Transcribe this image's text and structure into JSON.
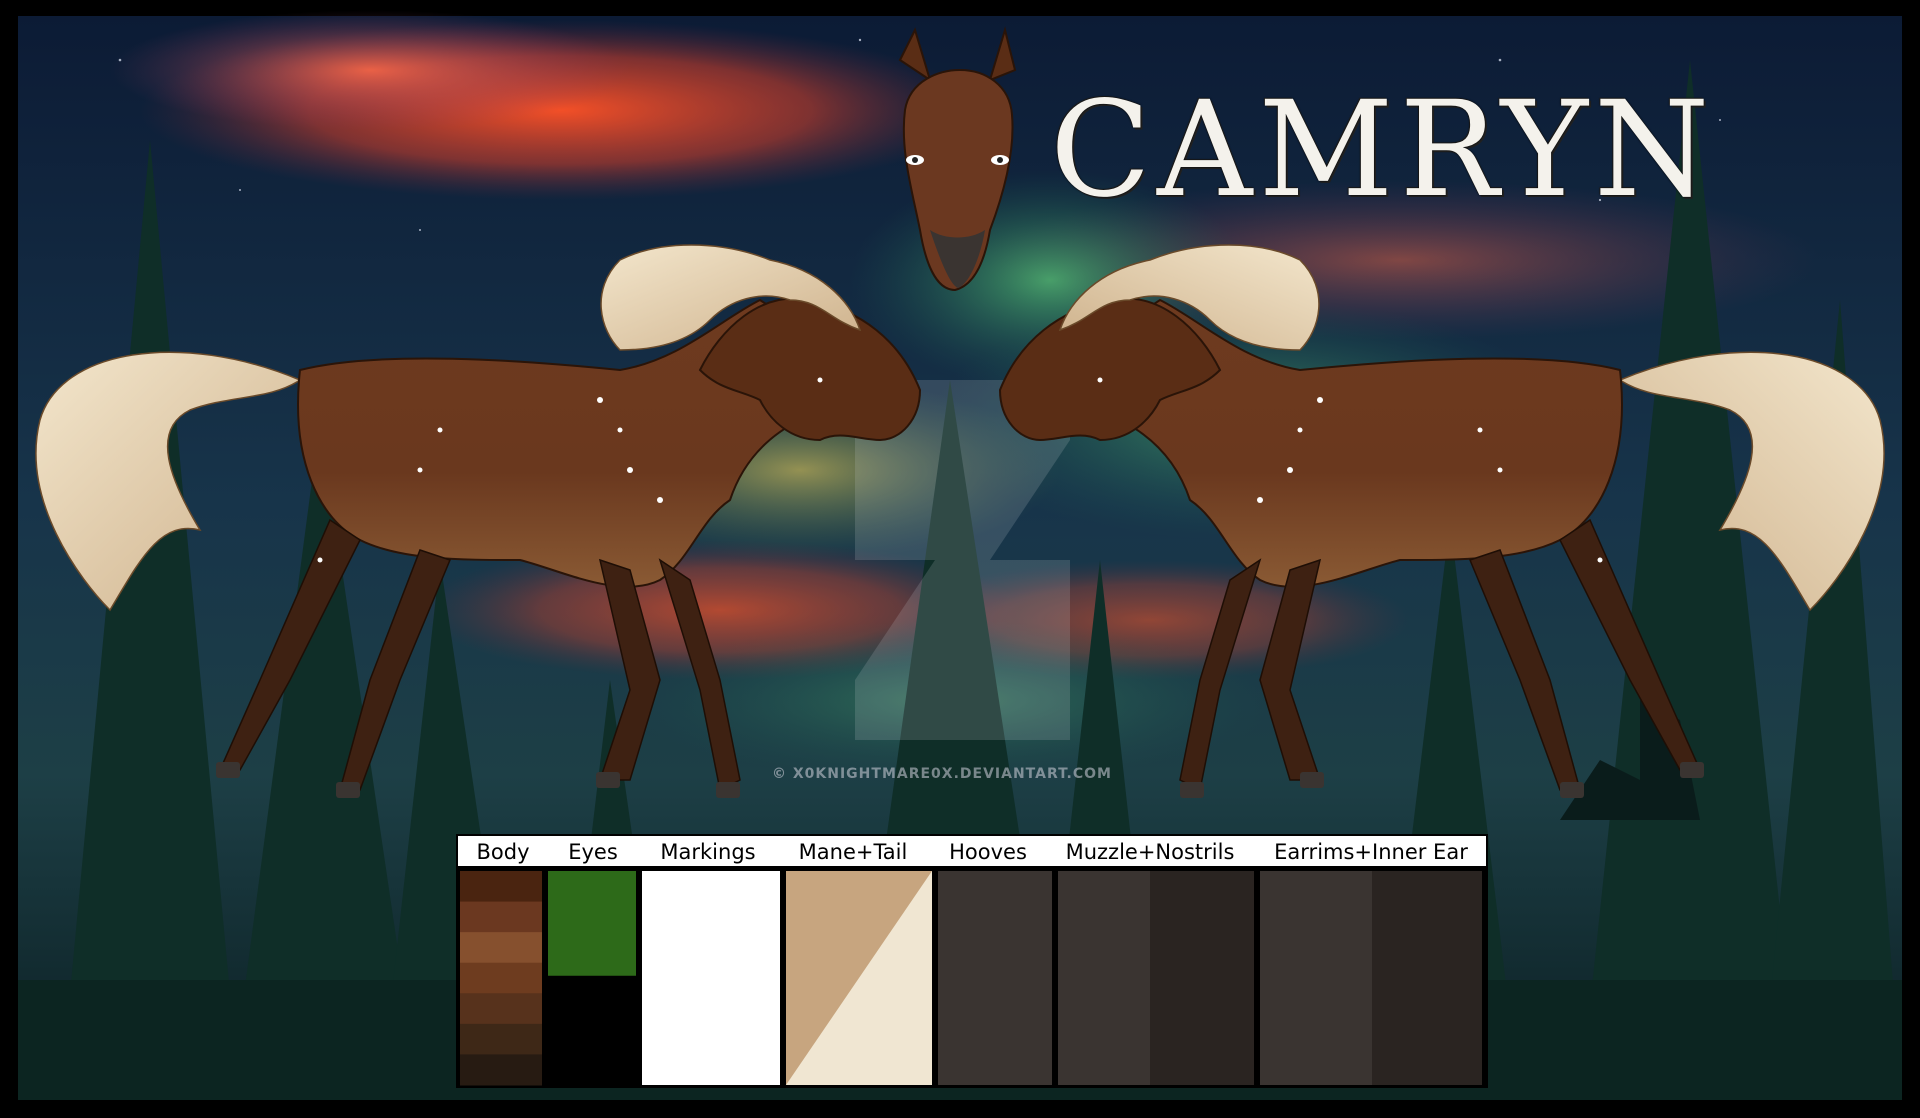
{
  "title": "CAMRYN",
  "watermark": "© X0KNIGHTMARE0X.DEVIANTART.COM",
  "palette": {
    "labels": {
      "body": "Body",
      "eyes": "Eyes",
      "markings": "Markings",
      "mane_tail": "Mane+Tail",
      "hooves": "Hooves",
      "muzzle_nostrils": "Muzzle+Nostrils",
      "earrims_inner_ear": "Earrims+Inner Ear"
    },
    "colors": {
      "body": [
        "#4a2410",
        "#6b3820",
        "#86502e",
        "#6e3c1f",
        "#57321c",
        "#3e2817",
        "#271b12"
      ],
      "eyes": [
        "#2d6a19",
        "#000000"
      ],
      "markings": [
        "#ffffff"
      ],
      "mane_tail": [
        "#c7a57f",
        "#f0e6d2"
      ],
      "hooves": [
        "#3a3431"
      ],
      "muzzle_nostrils": [
        "#3a3431",
        "#2a2421"
      ],
      "earrims_inner_ear": [
        "#3a3431",
        "#2a2421"
      ]
    }
  },
  "colors": {
    "coat": "#6b3820",
    "coat_light": "#8a5a34",
    "coat_dark": "#3e2112",
    "mane": "#e6d2ac",
    "mane_shadow": "#c7a57f",
    "hoof": "#3a3431",
    "sky_top": "#0b1a33",
    "aurora_red": "#ff5a2a",
    "aurora_green": "#3fae6a",
    "forest": "#0d2a25"
  }
}
